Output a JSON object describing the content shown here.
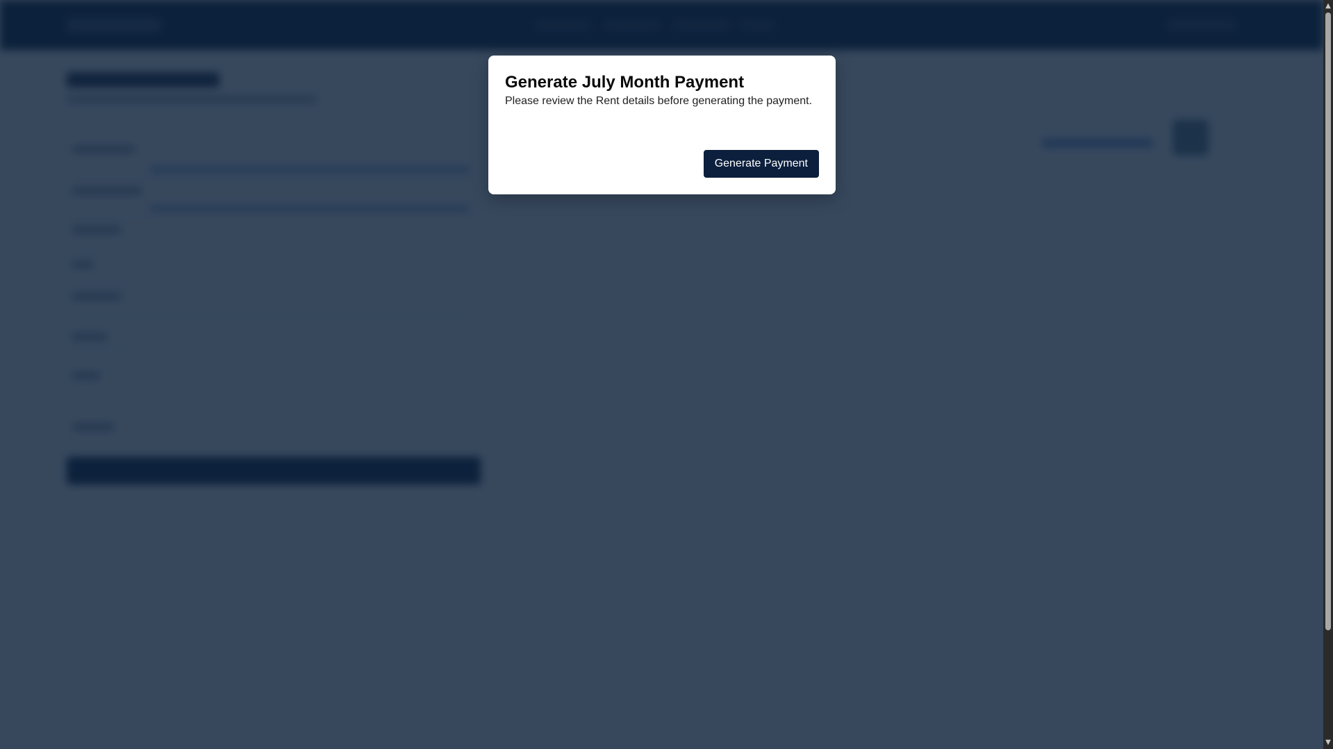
{
  "modal": {
    "title": "Generate July Month Payment",
    "description": "Please review the Rent details before generating the payment.",
    "button_label": "Generate Payment"
  },
  "scrollbar": {
    "up_arrow_icon": "triangle-up-icon",
    "down_arrow_icon": "triangle-down-icon"
  },
  "colors": {
    "navbar": "#031a38",
    "overlay": "#354757",
    "button": "#0c1f3d"
  }
}
